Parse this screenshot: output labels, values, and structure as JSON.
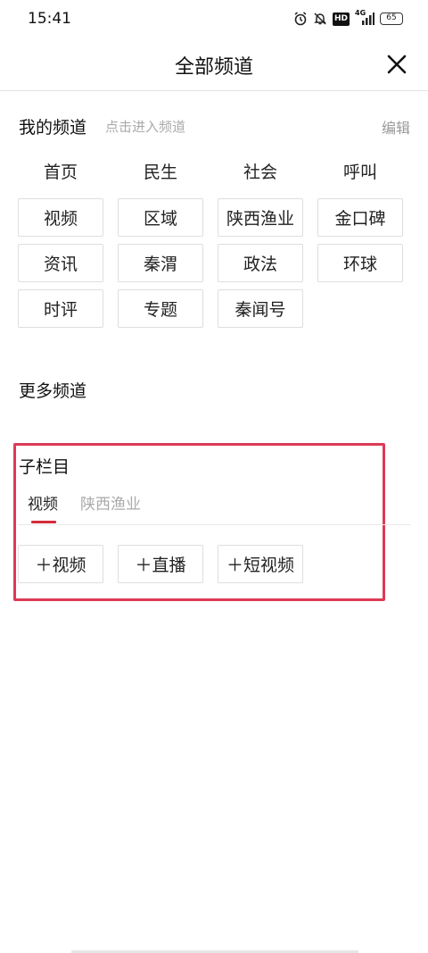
{
  "status_bar": {
    "time": "15:41",
    "network_badge": "HD",
    "network_type": "4G",
    "battery": "65"
  },
  "header": {
    "title": "全部频道",
    "close_icon": "close-icon"
  },
  "my_channels": {
    "title": "我的频道",
    "hint": "点击进入频道",
    "edit_label": "编辑",
    "fixed": [
      "首页",
      "民生",
      "社会",
      "呼叫"
    ],
    "items": [
      "视频",
      "区域",
      "陕西渔业",
      "金口碑",
      "资讯",
      "秦渭",
      "政法",
      "环球",
      "时评",
      "专题",
      "秦闻号"
    ]
  },
  "more_channels": {
    "title": "更多频道"
  },
  "sub_columns": {
    "title": "子栏目",
    "tabs": [
      {
        "label": "视频",
        "active": true
      },
      {
        "label": "陕西渔业",
        "active": false
      }
    ],
    "items": [
      "＋视频",
      "＋直播",
      "＋短视频"
    ],
    "accent_color": "#d42b3a",
    "highlight_color": "#de3a56"
  }
}
